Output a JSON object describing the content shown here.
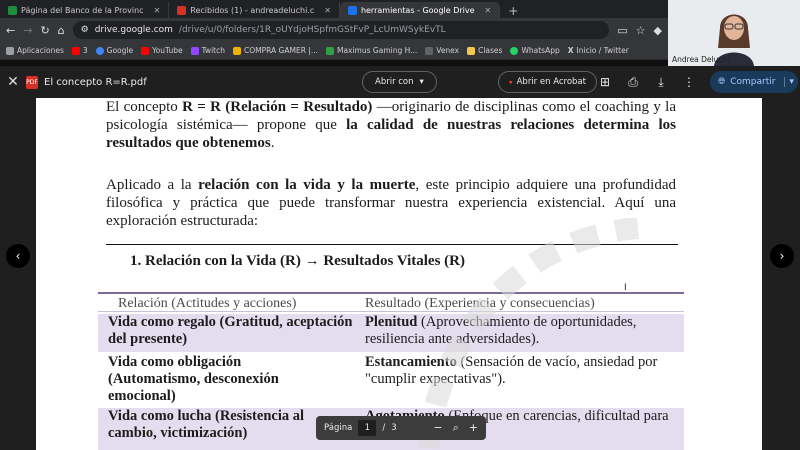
{
  "browser": {
    "tabs": [
      {
        "label": "Página del Banco de la Provinc",
        "color": "#1e8e3e",
        "icon": "bank-favicon"
      },
      {
        "label": "Recibidos (1) - andreadeluchi.c",
        "color": "#d93025",
        "icon": "gmail-favicon"
      },
      {
        "label": "herramientas - Google Drive",
        "color": "#1a73e8",
        "icon": "drive-favicon",
        "active": true
      }
    ],
    "new_tab": "+",
    "url_host": "drive.google.com",
    "url_path": "/drive/u/0/folders/1R_oUYdjoHSpfmGStFvP_LcUmWSykEvTL",
    "bookmarks": [
      {
        "label": "Aplicaciones",
        "icon": "apps-icon",
        "color": "#9aa0a6"
      },
      {
        "label": "3",
        "icon": "youtube-icon",
        "color": "#ff0000"
      },
      {
        "label": "Google",
        "icon": "google-icon",
        "color": "#4285f4"
      },
      {
        "label": "YouTube",
        "icon": "youtube-icon",
        "color": "#ff0000"
      },
      {
        "label": "Twitch",
        "icon": "twitch-icon",
        "color": "#9146ff"
      },
      {
        "label": "COMPRA GAMER |...",
        "icon": "store-icon",
        "color": "#f0b400"
      },
      {
        "label": "Maximus Gaming H...",
        "icon": "store-icon",
        "color": "#2ea043"
      },
      {
        "label": "Venex",
        "icon": "store-icon",
        "color": "#5f6368"
      },
      {
        "label": "Clases",
        "icon": "folder-icon",
        "color": "#f2c94c"
      },
      {
        "label": "WhatsApp",
        "icon": "whatsapp-icon",
        "color": "#25d366"
      },
      {
        "label": "Inicio / Twitter",
        "icon": "x-icon",
        "color": "#e8e8e8"
      }
    ]
  },
  "video": {
    "name": "Andrea Deluchi"
  },
  "viewer": {
    "file_title": "El concepto R=R.pdf",
    "open_with": "Abrir con",
    "acrobat": "Abrir en Acrobat",
    "share": "Compartir",
    "pager_label": "Página",
    "current_page": "1",
    "separator": "/",
    "total_pages": "3"
  },
  "document": {
    "p1_intro": "El concepto ",
    "p1_bold_term": "R = R (Relación = Resultado)",
    "p1_mid": " —originario de disciplinas como el coaching y la psicología sistémica— propone que ",
    "p1_bold_claim": "la calidad de nuestras relaciones determina los resultados que obtenemos",
    "p1_end": ".",
    "p2_intro": "Aplicado a la ",
    "p2_bold": "relación con la vida y la muerte",
    "p2_rest": ", este principio adquiere una profundidad filosófica y práctica que puede transformar nuestra experiencia existencial. Aquí una exploración estructurada:",
    "section_heading": "1.  Relación con la Vida (R) → Resultados Vitales (R)",
    "table": {
      "col1": "Relación (Actitudes y acciones)",
      "col2": "Resultado (Experiencia y consecuencias)",
      "rows": [
        {
          "relation": "Vida como regalo (Gratitud, aceptación del presente)",
          "result_bold": "Plenitud",
          "result_rest": " (Aprovechamiento de oportunidades, resiliencia ante adversidades)."
        },
        {
          "relation": "Vida como obligación (Automatismo, desconexión emocional)",
          "result_bold": "Estancamiento",
          "result_rest": " (Sensación de vacío, ansiedad por \"cumplir expectativas\")."
        },
        {
          "relation": "Vida como lucha (Resistencia al cambio, victimización)",
          "result_bold": "Agotamiento",
          "result_rest": " (Enfoque en carencias, dificultad para disfrutar logros)."
        }
      ]
    }
  },
  "colors": {
    "accent": "#a8c7fa",
    "table_shade": "#e4ddef",
    "table_rule": "#7b6a9a"
  }
}
